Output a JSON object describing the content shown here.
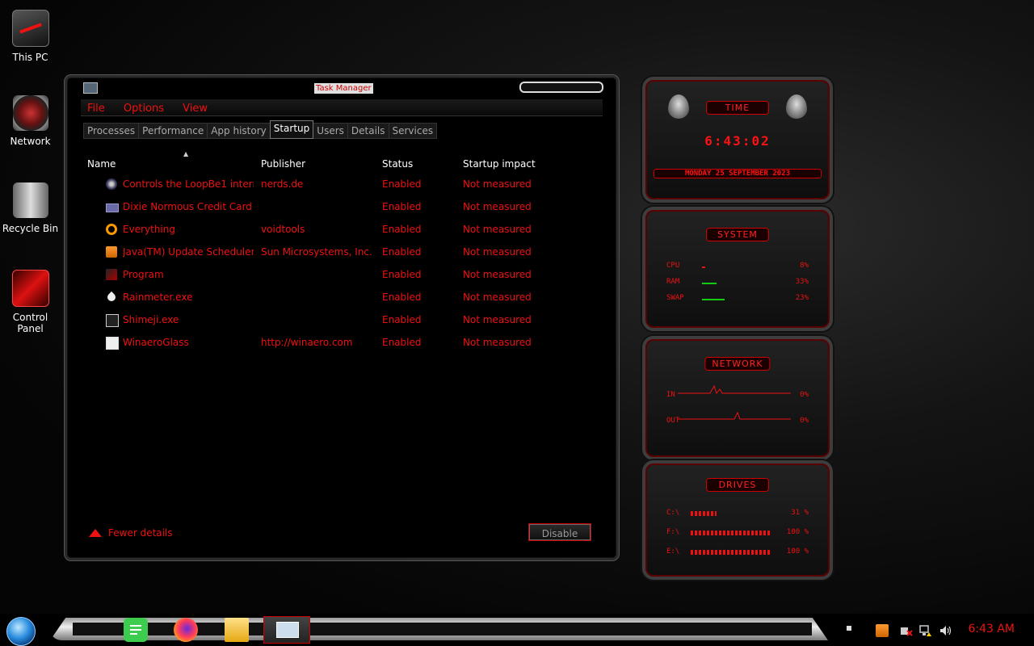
{
  "desktop": {
    "icons": [
      {
        "label": "This PC"
      },
      {
        "label": "Network"
      },
      {
        "label": "Recycle Bin"
      },
      {
        "label": "Control Panel"
      }
    ]
  },
  "task_manager": {
    "title": "Task Manager",
    "menu": [
      "File",
      "Options",
      "View"
    ],
    "tabs": [
      "Processes",
      "Performance",
      "App history",
      "Startup",
      "Users",
      "Details",
      "Services"
    ],
    "active_tab": "Startup",
    "columns": {
      "name": "Name",
      "publisher": "Publisher",
      "status": "Status",
      "impact": "Startup impact"
    },
    "rows": [
      {
        "name": "Controls the LoopBe1 intern...",
        "publisher": "nerds.de",
        "status": "Enabled",
        "impact": "Not measured",
        "icon": "loopbe-icon"
      },
      {
        "name": "Dixie Normous Credit Card S...",
        "publisher": "",
        "status": "Enabled",
        "impact": "Not measured",
        "icon": "credit-card-icon"
      },
      {
        "name": "Everything",
        "publisher": "voidtools",
        "status": "Enabled",
        "impact": "Not measured",
        "icon": "magnifier-icon"
      },
      {
        "name": "Java(TM) Update Scheduler",
        "publisher": "Sun Microsystems, Inc.",
        "status": "Enabled",
        "impact": "Not measured",
        "icon": "java-icon"
      },
      {
        "name": "Program",
        "publisher": "",
        "status": "Enabled",
        "impact": "Not measured",
        "icon": "program-icon"
      },
      {
        "name": "Rainmeter.exe",
        "publisher": "",
        "status": "Enabled",
        "impact": "Not measured",
        "icon": "raindrop-icon"
      },
      {
        "name": "Shimeji.exe",
        "publisher": "",
        "status": "Enabled",
        "impact": "Not measured",
        "icon": "window-icon"
      },
      {
        "name": "WinaeroGlass",
        "publisher": "http://winaero.com",
        "status": "Enabled",
        "impact": "Not measured",
        "icon": "window-icon"
      }
    ],
    "fewer_details": "Fewer details",
    "disable_button": "Disable"
  },
  "widgets": {
    "time": {
      "header": "TIME",
      "clock": "6:43:02",
      "date": "MONDAY 25 SEPTEMBER 2023"
    },
    "system": {
      "header": "SYSTEM",
      "rows": [
        {
          "label": "CPU",
          "value": "8%",
          "level": 0.08
        },
        {
          "label": "RAM",
          "value": "33%",
          "level": 0.33
        },
        {
          "label": "SWAP",
          "value": "23%",
          "level": 0.23
        }
      ]
    },
    "network": {
      "header": "NETWORK",
      "in_label": "IN",
      "in_value": "0%",
      "out_label": "OUT",
      "out_value": "0%"
    },
    "drives": {
      "header": "DRIVES",
      "rows": [
        {
          "label": "C:\\",
          "value": "31 %",
          "level": 0.31
        },
        {
          "label": "F:\\",
          "value": "100 %",
          "level": 1.0
        },
        {
          "label": "E:\\",
          "value": "100 %",
          "level": 1.0
        }
      ]
    }
  },
  "taskbar": {
    "clock": "6:43 AM",
    "accent": "#e11111"
  }
}
